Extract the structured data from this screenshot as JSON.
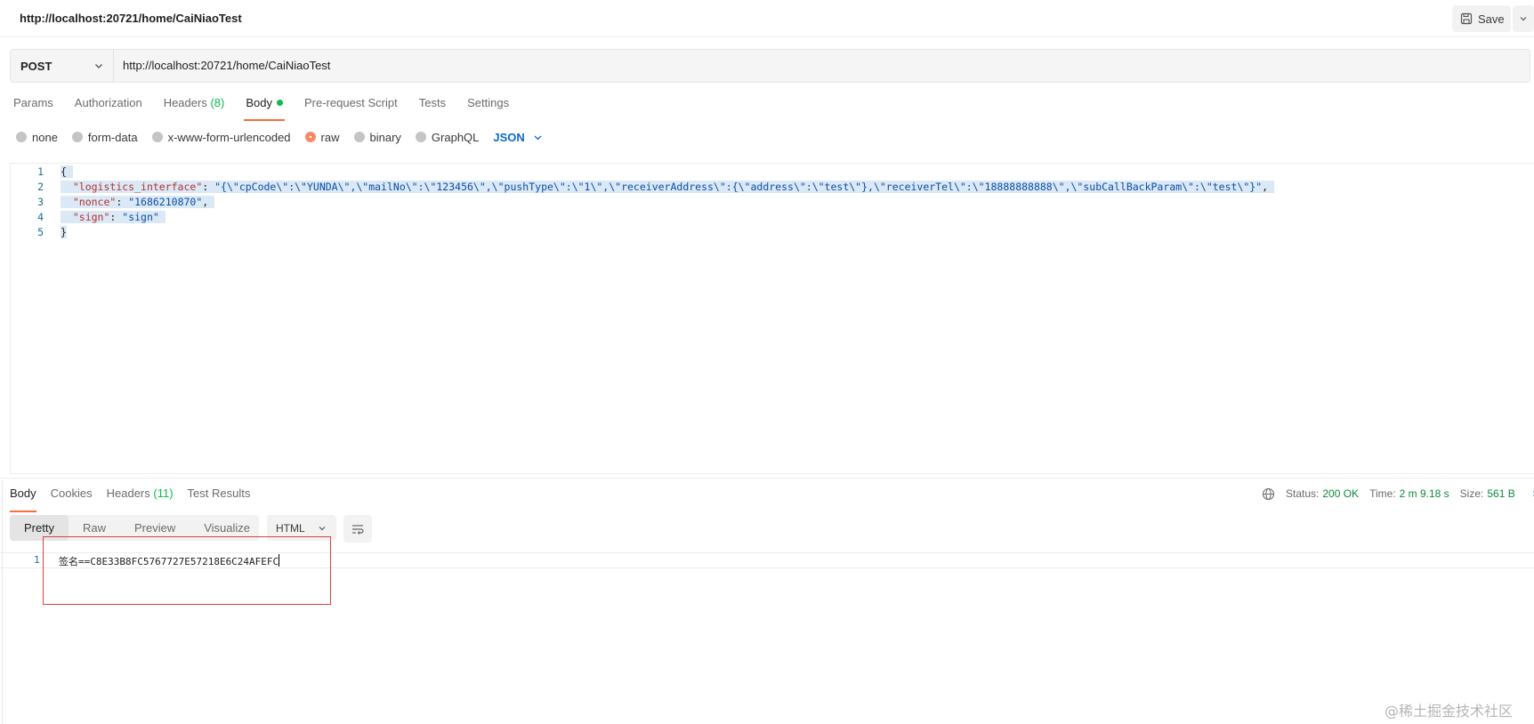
{
  "header": {
    "request_title": "http://localhost:20721/home/CaiNiaoTest",
    "save_label": "Save"
  },
  "request": {
    "method": "POST",
    "url": "http://localhost:20721/home/CaiNiaoTest"
  },
  "request_tabs": [
    {
      "label": "Params"
    },
    {
      "label": "Authorization"
    },
    {
      "label": "Headers",
      "count": "(8)"
    },
    {
      "label": "Body",
      "active": true
    },
    {
      "label": "Pre-request Script"
    },
    {
      "label": "Tests"
    },
    {
      "label": "Settings"
    }
  ],
  "body_types": {
    "options": [
      "none",
      "form-data",
      "x-www-form-urlencoded",
      "raw",
      "binary",
      "GraphQL"
    ],
    "selected": "raw",
    "format": "JSON"
  },
  "request_body": {
    "line_numbers": [
      "1",
      "2",
      "3",
      "4",
      "5"
    ],
    "line1": "{",
    "line2_key": "\"logistics_interface\"",
    "line2_sep": ": ",
    "line2_val": "\"{\\\"cpCode\\\":\\\"YUNDA\\\",\\\"mailNo\\\":\\\"123456\\\",\\\"pushType\\\":\\\"1\\\",\\\"receiverAddress\\\":{\\\"address\\\":\\\"test\\\"},\\\"receiverTel\\\":\\\"18888888888\\\",\\\"subCallBackParam\\\":\\\"test\\\"}\"",
    "line2_end": ",",
    "line3_key": "\"nonce\"",
    "line3_sep": ": ",
    "line3_val": "\"1686210870\"",
    "line3_end": ",",
    "line4_key": "\"sign\"",
    "line4_sep": ": ",
    "line4_val": "\"sign\"",
    "line5": "}"
  },
  "response_tabs": [
    {
      "label": "Body",
      "active": true
    },
    {
      "label": "Cookies"
    },
    {
      "label": "Headers",
      "count": "(11)"
    },
    {
      "label": "Test Results"
    }
  ],
  "response_status": {
    "status_label": "Status:",
    "status_value": "200 OK",
    "time_label": "Time:",
    "time_value": "2 m 9.18 s",
    "size_label": "Size:",
    "size_value": "561 B",
    "extra": "S"
  },
  "response_view": {
    "tabs": [
      "Pretty",
      "Raw",
      "Preview",
      "Visualize"
    ],
    "active": "Pretty",
    "format": "HTML"
  },
  "response_body": {
    "line_number": "1",
    "text": "签名==C8E33B8FC5767727E57218E6C24AFEFC"
  },
  "watermark": "@稀土掘金技术社区",
  "colors": {
    "accent": "#ff6c37",
    "success": "#0cbb52",
    "link": "#0b6bcb",
    "annotation_box": "#d9413e"
  }
}
